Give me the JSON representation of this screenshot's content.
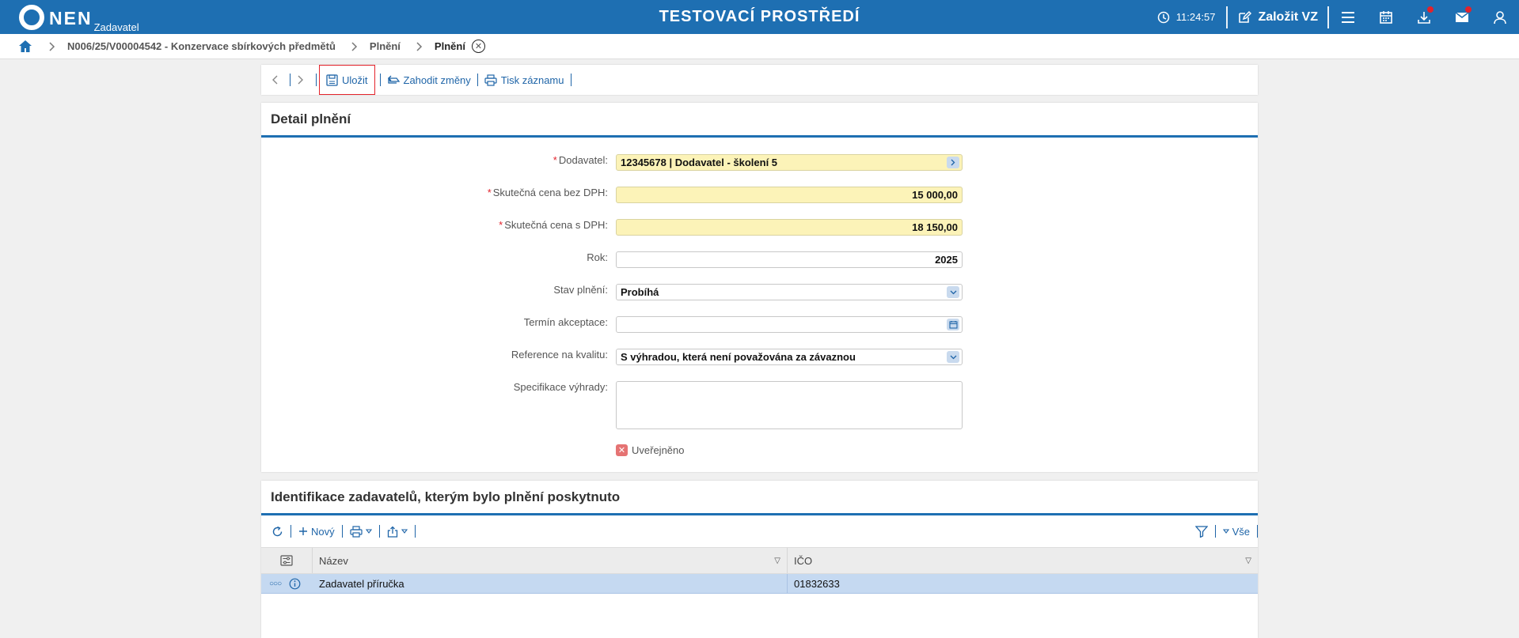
{
  "app": {
    "logo_text": "NEN",
    "logo_sub": "Zadavatel",
    "environment_title": "TESTOVACÍ PROSTŘEDÍ",
    "clock": "11:24:57",
    "create_label": "Založit VZ",
    "brand_color": "#1e6fb2",
    "notification_color": "#e2222c"
  },
  "breadcrumb": {
    "items": [
      "N006/25/V00004542 - Konzervace sbírkových předmětů",
      "Plnění"
    ],
    "current": "Plnění"
  },
  "toolbar": {
    "save": "Uložit",
    "discard": "Zahodit změny",
    "print": "Tisk záznamu"
  },
  "detail": {
    "title": "Detail plnění",
    "fields": {
      "supplier": {
        "label": "Dodavatel:",
        "value": "12345678 | Dodavatel - školení 5",
        "required": true
      },
      "price_no_vat": {
        "label": "Skutečná cena bez DPH:",
        "value": "15 000,00",
        "required": true
      },
      "price_vat": {
        "label": "Skutečná cena s DPH:",
        "value": "18 150,00",
        "required": true
      },
      "year": {
        "label": "Rok:",
        "value": "2025"
      },
      "state": {
        "label": "Stav plnění:",
        "value": "Probíhá"
      },
      "acceptance": {
        "label": "Termín akceptace:",
        "value": ""
      },
      "quality_ref": {
        "label": "Reference na kvalitu:",
        "value": "S výhradou, která není považována za závaznou"
      },
      "reservation_spec": {
        "label": "Specifikace výhrady:",
        "value": ""
      }
    },
    "published_label": "Uveřejněno",
    "published_checked": false
  },
  "ident": {
    "title": "Identifikace zadavatelů, kterým bylo plnění poskytnuto",
    "new_label": "Nový",
    "all_label": "Vše",
    "columns": [
      "Název",
      "IČO"
    ],
    "rows": [
      {
        "name": "Zadavatel příručka",
        "ico": "01832633"
      }
    ]
  }
}
